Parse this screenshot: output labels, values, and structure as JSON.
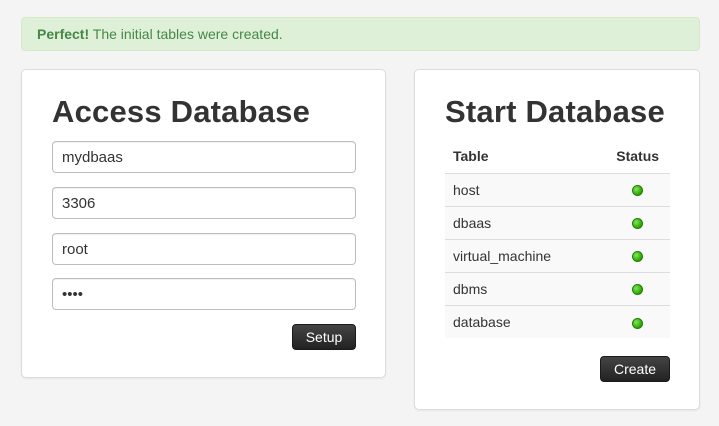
{
  "alert": {
    "strong": "Perfect!",
    "message": "The initial tables were created.",
    "color": "#468847",
    "background": "#dff0d8"
  },
  "access": {
    "title": "Access Database",
    "fields": {
      "host": "mydbaas",
      "port": "3306",
      "user": "root",
      "password": "abcd"
    },
    "setup_label": "Setup"
  },
  "start": {
    "title": "Start Database",
    "columns": {
      "table": "Table",
      "status": "Status"
    },
    "rows": [
      {
        "table": "host",
        "status": "ok"
      },
      {
        "table": "dbaas",
        "status": "ok"
      },
      {
        "table": "virtual_machine",
        "status": "ok"
      },
      {
        "table": "dbms",
        "status": "ok"
      },
      {
        "table": "database",
        "status": "ok"
      }
    ],
    "status_icon": "green-status-dot-icon",
    "status_color": "#2aa300",
    "create_label": "Create"
  }
}
